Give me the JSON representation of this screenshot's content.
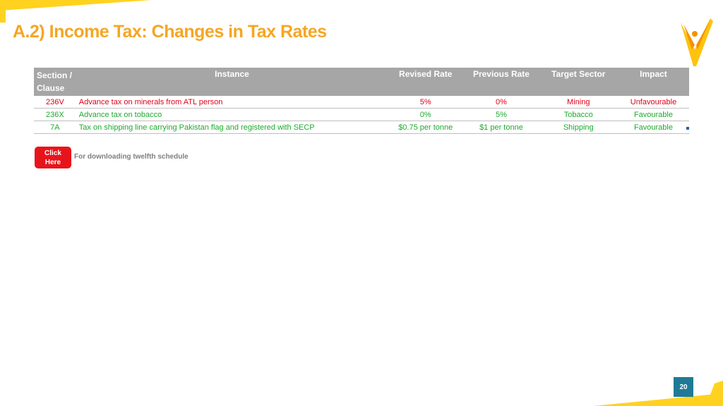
{
  "title": "A.2) Income Tax: Changes in Tax Rates",
  "table": {
    "headers": [
      "Section / Clause",
      "Instance",
      "Revised Rate",
      "Previous Rate",
      "Target Sector",
      "Impact"
    ],
    "rows": [
      {
        "section": "236V",
        "instance": "Advance tax on minerals from ATL person",
        "revised": "5%",
        "previous": "0%",
        "sector": "Mining",
        "impact": "Unfavourable"
      },
      {
        "section": "236X",
        "instance": "Advance tax on tobacco",
        "revised": "0%",
        "previous": "5%",
        "sector": "Tobacco",
        "impact": "Favourable"
      },
      {
        "section": "7A",
        "instance": "Tax on shipping line carrying Pakistan flag and registered with SECP",
        "revised": "$0.75 per tonne",
        "previous": "$1 per tonne",
        "sector": "Shipping",
        "impact": "Favourable"
      }
    ]
  },
  "click_button": {
    "label_line1": "Click",
    "label_line2": "Here"
  },
  "click_note": "For downloading twelfth schedule",
  "page_number": "20",
  "colors": {
    "accent": "#F5A623",
    "header_bg": "#A6A6A6",
    "unfavourable": "#E0001B",
    "favourable": "#1DAA2E",
    "button": "#E8141C",
    "page_badge": "#1F7A96"
  },
  "icons": {
    "logo": "checkmark-logo-icon"
  }
}
